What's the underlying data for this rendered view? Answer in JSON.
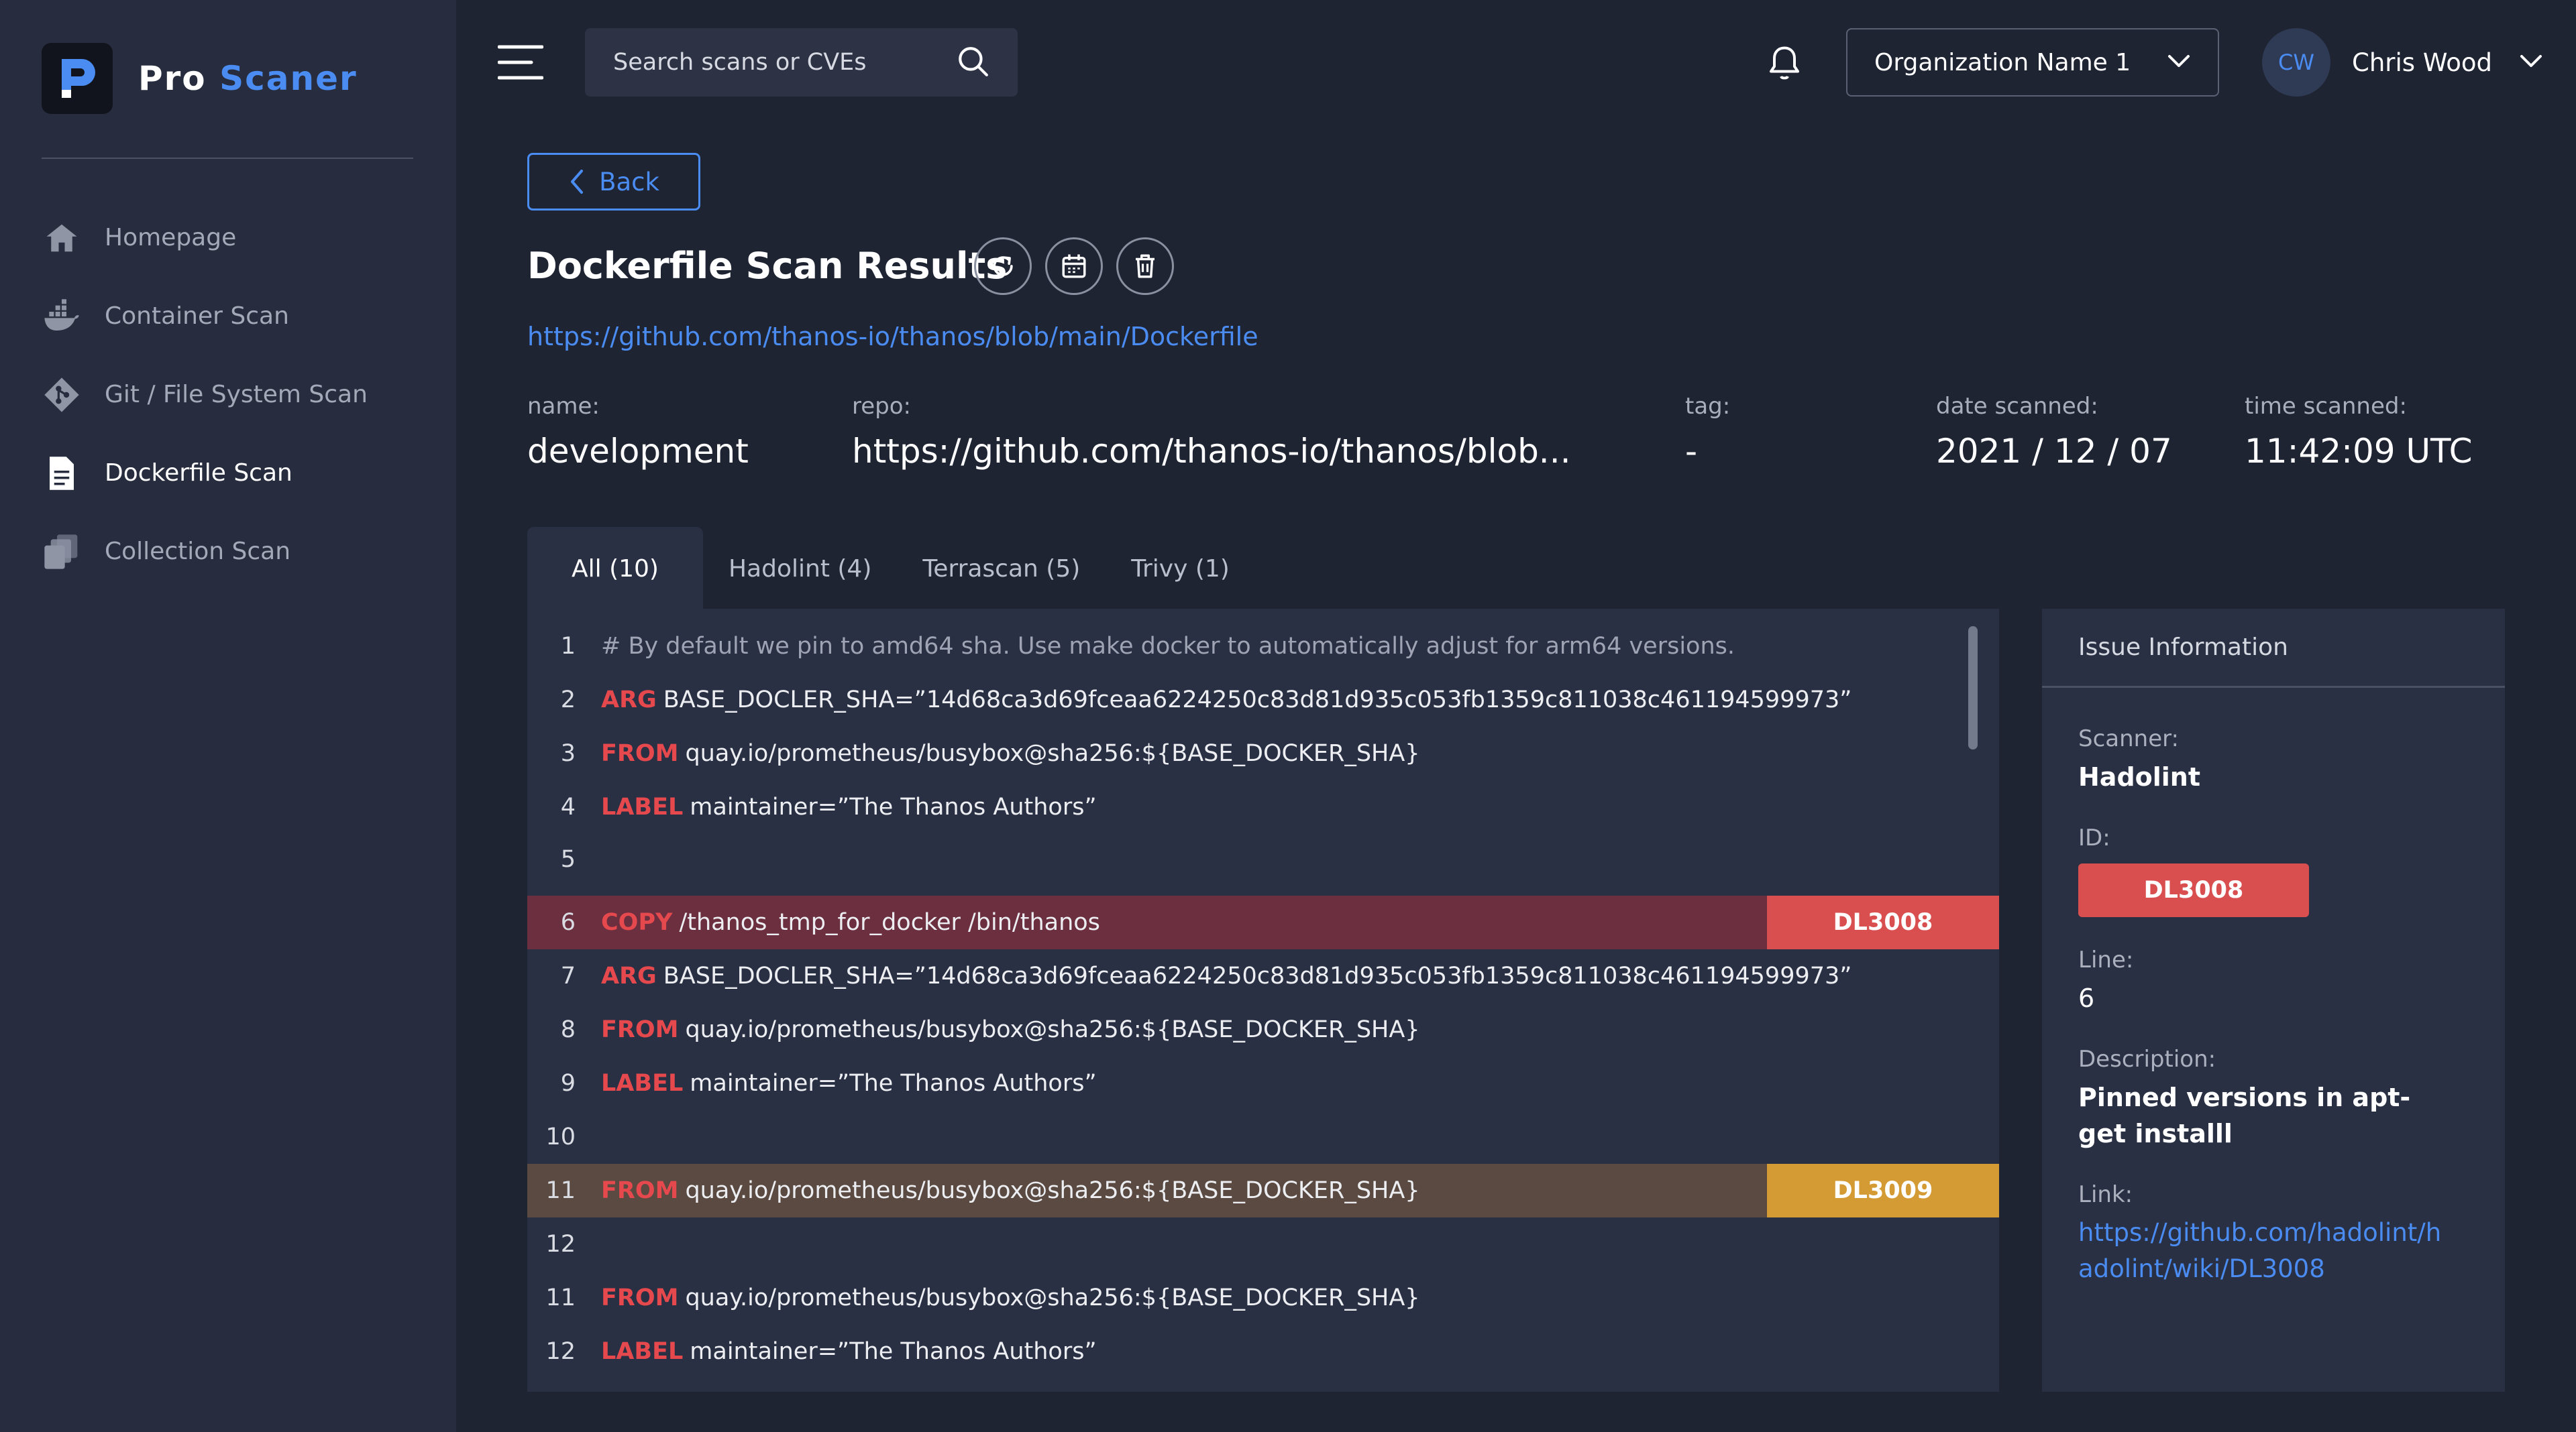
{
  "app": {
    "logo_part1": "Pro",
    "logo_part2": "Scaner",
    "accent_color": "#4a8cf1"
  },
  "sidebar": {
    "items": [
      {
        "label": "Homepage",
        "icon": "home-icon",
        "active": false
      },
      {
        "label": "Container Scan",
        "icon": "docker-icon",
        "active": false
      },
      {
        "label": "Git / File System Scan",
        "icon": "git-icon",
        "active": false
      },
      {
        "label": "Dockerfile Scan",
        "icon": "document-icon",
        "active": true
      },
      {
        "label": "Collection Scan",
        "icon": "collection-icon",
        "active": false
      }
    ]
  },
  "topbar": {
    "search_placeholder": "Search scans or CVEs",
    "organization": "Organization Name 1",
    "user_initials": "CW",
    "user_name": "Chris Wood"
  },
  "header": {
    "back_label": "Back",
    "title": "Dockerfile Scan Results",
    "repo_url": "https://github.com/thanos-io/thanos/blob/main/Dockerfile"
  },
  "meta": {
    "name_label": "name:",
    "name_value": "development",
    "repo_label": "repo:",
    "repo_value": "https://github.com/thanos-io/thanos/blob...",
    "tag_label": "tag:",
    "tag_value": "-",
    "date_label": "date scanned:",
    "date_value": "2021 / 12 / 07",
    "time_label": "time scanned:",
    "time_value": "11:42:09 UTC"
  },
  "tabs": [
    {
      "label": "All (10)",
      "active": true
    },
    {
      "label": "Hadolint (4)",
      "active": false
    },
    {
      "label": "Terrascan (5)",
      "active": false
    },
    {
      "label": "Trivy (1)",
      "active": false
    }
  ],
  "code_lines": [
    {
      "num": "1",
      "kw": "",
      "text": "# By default we pin to amd64 sha. Use make docker to automatically adjust for arm64 versions.",
      "comment": true,
      "highlight": "",
      "badge": ""
    },
    {
      "num": "2",
      "kw": "ARG",
      "text": "BASE_DOCLER_SHA=”14d68ca3d69fceaa6224250c83d81d935c053fb1359c811038c461194599973”",
      "comment": false,
      "highlight": "",
      "badge": ""
    },
    {
      "num": "3",
      "kw": "FROM",
      "text": "quay.io/prometheus/busybox@sha256:${BASE_DOCKER_SHA}",
      "comment": false,
      "highlight": "",
      "badge": ""
    },
    {
      "num": "4",
      "kw": "LABEL",
      "text": "maintainer=”The Thanos Authors”",
      "comment": false,
      "highlight": "",
      "badge": ""
    },
    {
      "num": "5",
      "kw": "",
      "text": "",
      "comment": false,
      "highlight": "",
      "badge": ""
    },
    {
      "num": "6",
      "kw": "COPY",
      "text": "/thanos_tmp_for_docker /bin/thanos",
      "comment": false,
      "highlight": "red",
      "badge": "DL3008"
    },
    {
      "num": "7",
      "kw": "ARG",
      "text": "BASE_DOCLER_SHA=”14d68ca3d69fceaa6224250c83d81d935c053fb1359c811038c461194599973”",
      "comment": false,
      "highlight": "",
      "badge": ""
    },
    {
      "num": "8",
      "kw": "FROM",
      "text": "quay.io/prometheus/busybox@sha256:${BASE_DOCKER_SHA}",
      "comment": false,
      "highlight": "",
      "badge": ""
    },
    {
      "num": "9",
      "kw": "LABEL",
      "text": "maintainer=”The Thanos Authors”",
      "comment": false,
      "highlight": "",
      "badge": ""
    },
    {
      "num": "10",
      "kw": "",
      "text": "",
      "comment": false,
      "highlight": "",
      "badge": ""
    },
    {
      "num": "11",
      "kw": "FROM",
      "text": "quay.io/prometheus/busybox@sha256:${BASE_DOCKER_SHA}",
      "comment": false,
      "highlight": "orange",
      "badge": "DL3009"
    },
    {
      "num": "12",
      "kw": "",
      "text": "",
      "comment": false,
      "highlight": "",
      "badge": ""
    },
    {
      "num": "11",
      "kw": "FROM",
      "text": "quay.io/prometheus/busybox@sha256:${BASE_DOCKER_SHA}",
      "comment": false,
      "highlight": "",
      "badge": ""
    },
    {
      "num": "12",
      "kw": "LABEL",
      "text": "maintainer=”The Thanos Authors”",
      "comment": false,
      "highlight": "",
      "badge": ""
    }
  ],
  "issue": {
    "heading": "Issue Information",
    "scanner_label": "Scanner:",
    "scanner_value": "Hadolint",
    "id_label": "ID:",
    "id_value": "DL3008",
    "line_label": "Line:",
    "line_value": "6",
    "description_label": "Description:",
    "description_value": "Pinned versions in apt-get installl",
    "link_label": "Link:",
    "link_value": "https://github.com/hadolint/hadolint/wiki/DL3008"
  }
}
